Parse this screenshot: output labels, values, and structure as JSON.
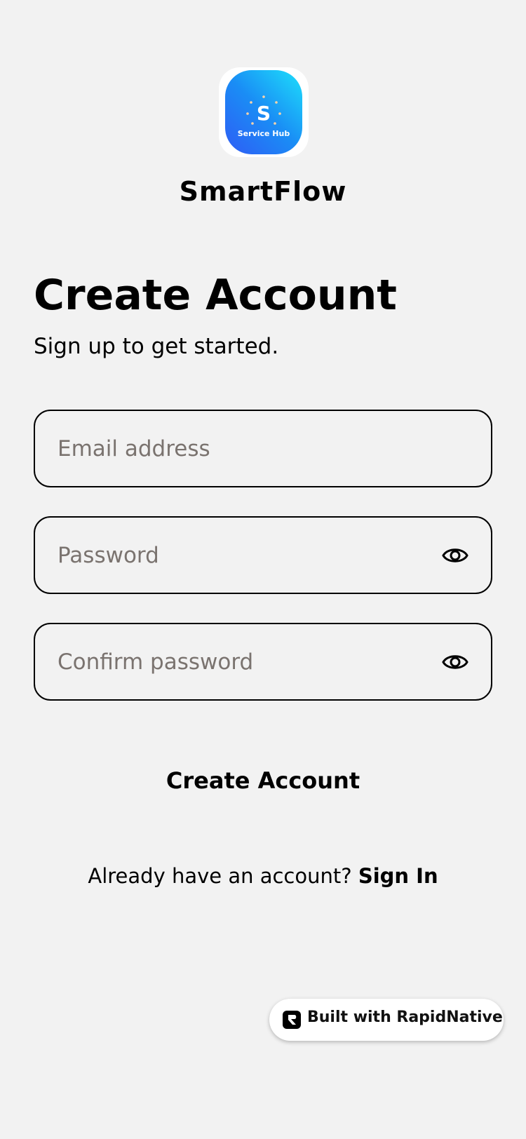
{
  "app": {
    "name": "SmartFlow",
    "icon_label": "Service Hub",
    "icon_letter": "S",
    "icon_name": "service-hub-logo-icon",
    "gradient_colors": [
      "#2f5cf5",
      "#1de0fb"
    ]
  },
  "header": {
    "title": "Create Account",
    "subtitle": "Sign up to get started."
  },
  "form": {
    "email": {
      "placeholder": "Email address",
      "value": ""
    },
    "password": {
      "placeholder": "Password",
      "value": "",
      "toggle_icon": "eye-icon"
    },
    "confirm_password": {
      "placeholder": "Confirm password",
      "value": "",
      "toggle_icon": "eye-icon"
    },
    "submit_label": "Create Account"
  },
  "footer": {
    "prompt": "Already have an account?",
    "link_label": "Sign In"
  },
  "badge": {
    "label": "Built with RapidNative",
    "icon_name": "rapidnative-logo-icon"
  },
  "colors": {
    "background": "#f2f2f2",
    "text": "#000000",
    "placeholder": "#7a736f",
    "border": "#000000"
  }
}
